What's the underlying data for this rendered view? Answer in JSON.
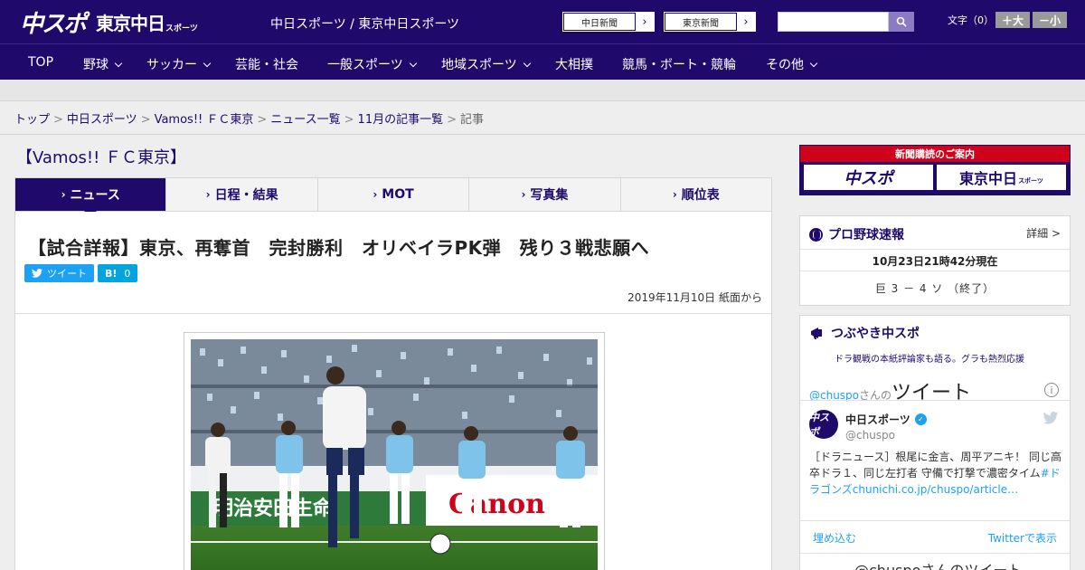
{
  "header": {
    "logo_main": "中スポ",
    "logo_sub": "東京中日",
    "logo_small": "スポーツ",
    "site_names": "中日スポーツ / 東京中日スポーツ",
    "paper_btn_1": "中日新聞",
    "paper_btn_2": "東京新聞",
    "font_label": "文字（0）",
    "font_plus": "＋大",
    "font_minus": "－小",
    "search_placeholder": ""
  },
  "nav": {
    "items": [
      "TOP",
      "野球",
      "サッカー",
      "芸能・社会",
      "一般スポーツ",
      "地域スポーツ",
      "大相撲",
      "競馬・ボート・競輪",
      "その他"
    ]
  },
  "breadcrumb": {
    "items": [
      "トップ",
      "中日スポーツ",
      "Vamos!! ＦＣ東京",
      "ニュース一覧",
      "11月の記事一覧"
    ],
    "current": "記事",
    "sep": ">"
  },
  "section_title": "【Vamos!! ＦＣ東京】",
  "tabs": [
    "ニュース",
    "日程・結果",
    "MOT",
    "写真集",
    "順位表"
  ],
  "article": {
    "headline": "【試合詳報】東京、再奪首　完封勝利　オリベイラPK弾　残り３戦悲願へ",
    "tweet_label": "ツイート",
    "hatena_label": "B!",
    "hatena_count": "0",
    "date": "2019年11月10日 紙面から"
  },
  "sidebar": {
    "ad_head": "新聞購読のご案内",
    "ad_logo_1": "中スポ",
    "ad_logo_2": "東京中日",
    "ad_logo_2_small": "スポーツ",
    "baseball": {
      "title": "プロ野球速報",
      "detail": "詳細 >",
      "time": "10月23日21時42分現在",
      "score": "巨 3 － 4 ソ （終了）"
    },
    "twitter": {
      "title": "つぶやき中スポ",
      "subtitle": "ドラ観戦の本紙評論家も語る。グラも熱烈応援",
      "header_handle": "@chuspo",
      "header_san": "さんの",
      "header_tweet": "ツイート",
      "name": "中日スポーツ",
      "avatar_text": "中スポ",
      "handle": "@chuspo",
      "text_plain": "［ドラニュース］根尾に金言、周平アニキ！ 同じ高卒ドラ１、同じ左打者 守備で打撃で濃密タイム",
      "text_link": "#ドラゴンズchunichi.co.jp/chuspo/article…",
      "embed": "埋め込む",
      "view_on": "Twitterで表示",
      "footer": "@chuspoさんのツイート"
    }
  },
  "colors": {
    "brand": "#1f0a6b",
    "twitter": "#1da1f2",
    "ad_red": "#d0021b"
  }
}
